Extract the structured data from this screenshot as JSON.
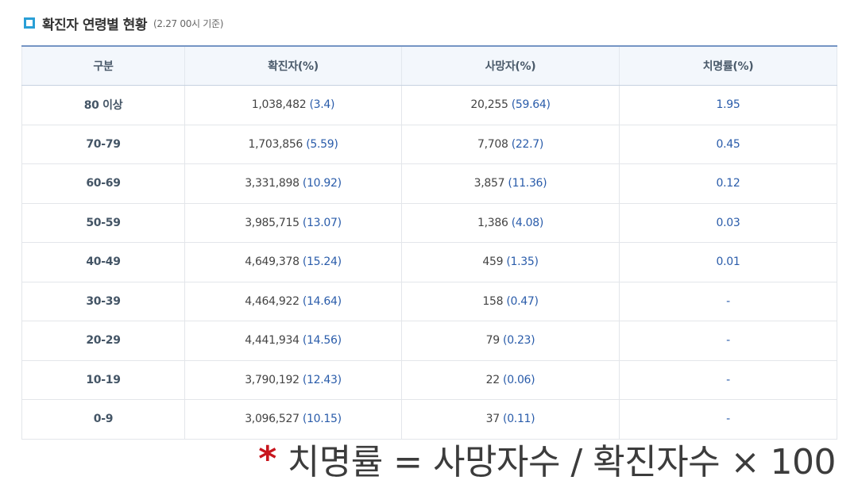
{
  "header": {
    "title": "확진자 연령별 현황",
    "subtitle": "(2.27 00시 기준)"
  },
  "table": {
    "columns": [
      "구분",
      "확진자(%)",
      "사망자(%)",
      "치명률(%)"
    ],
    "rows": [
      {
        "group": "80 이상",
        "cases": "1,038,482",
        "cases_pct": "(3.4)",
        "deaths": "20,255",
        "deaths_pct": "(59.64)",
        "cfr": "1.95"
      },
      {
        "group": "70-79",
        "cases": "1,703,856",
        "cases_pct": "(5.59)",
        "deaths": "7,708",
        "deaths_pct": "(22.7)",
        "cfr": "0.45"
      },
      {
        "group": "60-69",
        "cases": "3,331,898",
        "cases_pct": "(10.92)",
        "deaths": "3,857",
        "deaths_pct": "(11.36)",
        "cfr": "0.12"
      },
      {
        "group": "50-59",
        "cases": "3,985,715",
        "cases_pct": "(13.07)",
        "deaths": "1,386",
        "deaths_pct": "(4.08)",
        "cfr": "0.03"
      },
      {
        "group": "40-49",
        "cases": "4,649,378",
        "cases_pct": "(15.24)",
        "deaths": "459",
        "deaths_pct": "(1.35)",
        "cfr": "0.01"
      },
      {
        "group": "30-39",
        "cases": "4,464,922",
        "cases_pct": "(14.64)",
        "deaths": "158",
        "deaths_pct": "(0.47)",
        "cfr": "-"
      },
      {
        "group": "20-29",
        "cases": "4,441,934",
        "cases_pct": "(14.56)",
        "deaths": "79",
        "deaths_pct": "(0.23)",
        "cfr": "-"
      },
      {
        "group": "10-19",
        "cases": "3,790,192",
        "cases_pct": "(12.43)",
        "deaths": "22",
        "deaths_pct": "(0.06)",
        "cfr": "-"
      },
      {
        "group": "0-9",
        "cases": "3,096,527",
        "cases_pct": "(10.15)",
        "deaths": "37",
        "deaths_pct": "(0.11)",
        "cfr": "-"
      }
    ]
  },
  "note": {
    "asterisk": "*",
    "text": "치명률 = 사망자수 / 확진자수 × 100"
  },
  "colors": {
    "accent": "#2a9fd6",
    "header_border": "#7595c4",
    "pct_text": "#2a5caa",
    "asterisk": "#c8161e"
  }
}
